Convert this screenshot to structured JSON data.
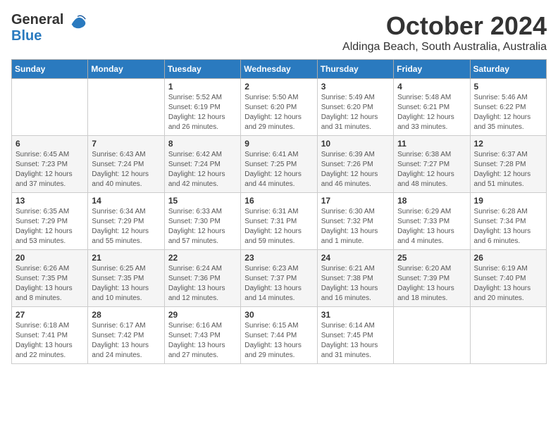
{
  "header": {
    "logo_line1": "General",
    "logo_line2": "Blue",
    "month": "October 2024",
    "location": "Aldinga Beach, South Australia, Australia"
  },
  "weekdays": [
    "Sunday",
    "Monday",
    "Tuesday",
    "Wednesday",
    "Thursday",
    "Friday",
    "Saturday"
  ],
  "weeks": [
    [
      {
        "day": "",
        "sunrise": "",
        "sunset": "",
        "daylight": ""
      },
      {
        "day": "",
        "sunrise": "",
        "sunset": "",
        "daylight": ""
      },
      {
        "day": "1",
        "sunrise": "Sunrise: 5:52 AM",
        "sunset": "Sunset: 6:19 PM",
        "daylight": "Daylight: 12 hours and 26 minutes."
      },
      {
        "day": "2",
        "sunrise": "Sunrise: 5:50 AM",
        "sunset": "Sunset: 6:20 PM",
        "daylight": "Daylight: 12 hours and 29 minutes."
      },
      {
        "day": "3",
        "sunrise": "Sunrise: 5:49 AM",
        "sunset": "Sunset: 6:20 PM",
        "daylight": "Daylight: 12 hours and 31 minutes."
      },
      {
        "day": "4",
        "sunrise": "Sunrise: 5:48 AM",
        "sunset": "Sunset: 6:21 PM",
        "daylight": "Daylight: 12 hours and 33 minutes."
      },
      {
        "day": "5",
        "sunrise": "Sunrise: 5:46 AM",
        "sunset": "Sunset: 6:22 PM",
        "daylight": "Daylight: 12 hours and 35 minutes."
      }
    ],
    [
      {
        "day": "6",
        "sunrise": "Sunrise: 6:45 AM",
        "sunset": "Sunset: 7:23 PM",
        "daylight": "Daylight: 12 hours and 37 minutes."
      },
      {
        "day": "7",
        "sunrise": "Sunrise: 6:43 AM",
        "sunset": "Sunset: 7:24 PM",
        "daylight": "Daylight: 12 hours and 40 minutes."
      },
      {
        "day": "8",
        "sunrise": "Sunrise: 6:42 AM",
        "sunset": "Sunset: 7:24 PM",
        "daylight": "Daylight: 12 hours and 42 minutes."
      },
      {
        "day": "9",
        "sunrise": "Sunrise: 6:41 AM",
        "sunset": "Sunset: 7:25 PM",
        "daylight": "Daylight: 12 hours and 44 minutes."
      },
      {
        "day": "10",
        "sunrise": "Sunrise: 6:39 AM",
        "sunset": "Sunset: 7:26 PM",
        "daylight": "Daylight: 12 hours and 46 minutes."
      },
      {
        "day": "11",
        "sunrise": "Sunrise: 6:38 AM",
        "sunset": "Sunset: 7:27 PM",
        "daylight": "Daylight: 12 hours and 48 minutes."
      },
      {
        "day": "12",
        "sunrise": "Sunrise: 6:37 AM",
        "sunset": "Sunset: 7:28 PM",
        "daylight": "Daylight: 12 hours and 51 minutes."
      }
    ],
    [
      {
        "day": "13",
        "sunrise": "Sunrise: 6:35 AM",
        "sunset": "Sunset: 7:29 PM",
        "daylight": "Daylight: 12 hours and 53 minutes."
      },
      {
        "day": "14",
        "sunrise": "Sunrise: 6:34 AM",
        "sunset": "Sunset: 7:29 PM",
        "daylight": "Daylight: 12 hours and 55 minutes."
      },
      {
        "day": "15",
        "sunrise": "Sunrise: 6:33 AM",
        "sunset": "Sunset: 7:30 PM",
        "daylight": "Daylight: 12 hours and 57 minutes."
      },
      {
        "day": "16",
        "sunrise": "Sunrise: 6:31 AM",
        "sunset": "Sunset: 7:31 PM",
        "daylight": "Daylight: 12 hours and 59 minutes."
      },
      {
        "day": "17",
        "sunrise": "Sunrise: 6:30 AM",
        "sunset": "Sunset: 7:32 PM",
        "daylight": "Daylight: 13 hours and 1 minute."
      },
      {
        "day": "18",
        "sunrise": "Sunrise: 6:29 AM",
        "sunset": "Sunset: 7:33 PM",
        "daylight": "Daylight: 13 hours and 4 minutes."
      },
      {
        "day": "19",
        "sunrise": "Sunrise: 6:28 AM",
        "sunset": "Sunset: 7:34 PM",
        "daylight": "Daylight: 13 hours and 6 minutes."
      }
    ],
    [
      {
        "day": "20",
        "sunrise": "Sunrise: 6:26 AM",
        "sunset": "Sunset: 7:35 PM",
        "daylight": "Daylight: 13 hours and 8 minutes."
      },
      {
        "day": "21",
        "sunrise": "Sunrise: 6:25 AM",
        "sunset": "Sunset: 7:35 PM",
        "daylight": "Daylight: 13 hours and 10 minutes."
      },
      {
        "day": "22",
        "sunrise": "Sunrise: 6:24 AM",
        "sunset": "Sunset: 7:36 PM",
        "daylight": "Daylight: 13 hours and 12 minutes."
      },
      {
        "day": "23",
        "sunrise": "Sunrise: 6:23 AM",
        "sunset": "Sunset: 7:37 PM",
        "daylight": "Daylight: 13 hours and 14 minutes."
      },
      {
        "day": "24",
        "sunrise": "Sunrise: 6:21 AM",
        "sunset": "Sunset: 7:38 PM",
        "daylight": "Daylight: 13 hours and 16 minutes."
      },
      {
        "day": "25",
        "sunrise": "Sunrise: 6:20 AM",
        "sunset": "Sunset: 7:39 PM",
        "daylight": "Daylight: 13 hours and 18 minutes."
      },
      {
        "day": "26",
        "sunrise": "Sunrise: 6:19 AM",
        "sunset": "Sunset: 7:40 PM",
        "daylight": "Daylight: 13 hours and 20 minutes."
      }
    ],
    [
      {
        "day": "27",
        "sunrise": "Sunrise: 6:18 AM",
        "sunset": "Sunset: 7:41 PM",
        "daylight": "Daylight: 13 hours and 22 minutes."
      },
      {
        "day": "28",
        "sunrise": "Sunrise: 6:17 AM",
        "sunset": "Sunset: 7:42 PM",
        "daylight": "Daylight: 13 hours and 24 minutes."
      },
      {
        "day": "29",
        "sunrise": "Sunrise: 6:16 AM",
        "sunset": "Sunset: 7:43 PM",
        "daylight": "Daylight: 13 hours and 27 minutes."
      },
      {
        "day": "30",
        "sunrise": "Sunrise: 6:15 AM",
        "sunset": "Sunset: 7:44 PM",
        "daylight": "Daylight: 13 hours and 29 minutes."
      },
      {
        "day": "31",
        "sunrise": "Sunrise: 6:14 AM",
        "sunset": "Sunset: 7:45 PM",
        "daylight": "Daylight: 13 hours and 31 minutes."
      },
      {
        "day": "",
        "sunrise": "",
        "sunset": "",
        "daylight": ""
      },
      {
        "day": "",
        "sunrise": "",
        "sunset": "",
        "daylight": ""
      }
    ]
  ]
}
